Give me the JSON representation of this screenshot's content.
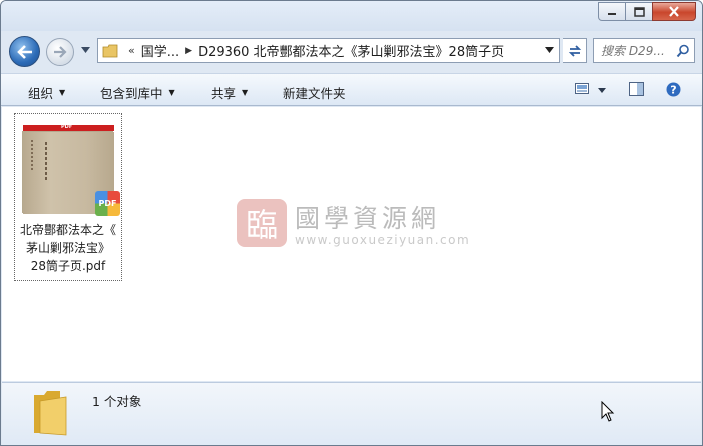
{
  "window": {
    "buttons": {
      "minimize_icon": "minimize-icon",
      "maximize_icon": "maximize-icon",
      "close_icon": "close-icon"
    }
  },
  "address": {
    "crumbs": [
      "国学...",
      "D29360 北帝酆都法本之《茅山剿邪法宝》28筒子页"
    ],
    "overflow_marker": "«",
    "search_placeholder": "搜索 D29..."
  },
  "commands": {
    "organize": "组织",
    "include_in_library": "包含到库中",
    "share": "共享",
    "new_folder": "新建文件夹"
  },
  "file": {
    "name": "北帝酆都法本之《茅山剿邪法宝》28筒子页.pdf",
    "name_lines": [
      "北帝酆都法本之《",
      "茅山剿邪法宝》",
      "28筒子页.pdf"
    ],
    "thumb_label": "PDF",
    "badge": "PDF"
  },
  "watermark": {
    "seal": "臨",
    "title": "國學資源網",
    "url": "www.guoxueziyuan.com"
  },
  "details": {
    "count_text": "1 个对象"
  },
  "colors": {
    "frame": "#dfe8f3",
    "accent_blue": "#2c6bb7",
    "close_red": "#c9462c",
    "watermark_seal": "#e8b8b4"
  }
}
